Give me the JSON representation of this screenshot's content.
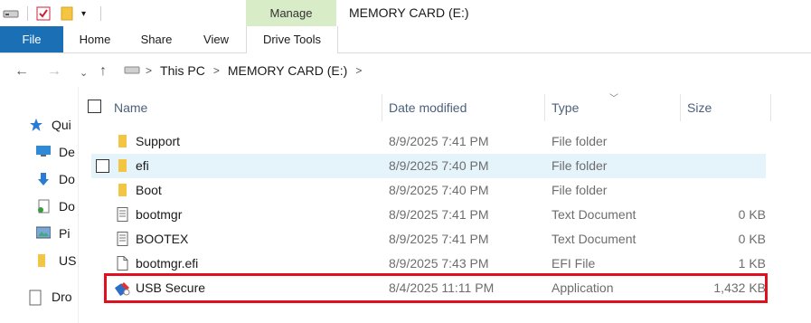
{
  "window": {
    "title": "MEMORY CARD (E:)",
    "context_tab_group": "Manage"
  },
  "ribbon": {
    "tabs": [
      {
        "label": "File"
      },
      {
        "label": "Home"
      },
      {
        "label": "Share"
      },
      {
        "label": "View"
      },
      {
        "label": "Drive Tools"
      }
    ]
  },
  "address": {
    "crumbs": [
      "This PC",
      "MEMORY CARD (E:)"
    ]
  },
  "nav_pane": {
    "items": [
      {
        "label": "Qui",
        "icon": "star-icon"
      },
      {
        "label": "De",
        "icon": "desktop-icon"
      },
      {
        "label": "Do",
        "icon": "download-icon"
      },
      {
        "label": "Do",
        "icon": "documents-icon"
      },
      {
        "label": "Pi",
        "icon": "pictures-icon"
      },
      {
        "label": "US",
        "icon": "folder-icon"
      },
      {
        "label": "Dro",
        "icon": "drive-icon"
      }
    ]
  },
  "columns": {
    "name": "Name",
    "date": "Date modified",
    "type": "Type",
    "size": "Size"
  },
  "files": [
    {
      "name": "Support",
      "date": "8/9/2025 7:41 PM",
      "type": "File folder",
      "size": "",
      "icon": "folder-icon"
    },
    {
      "name": "efi",
      "date": "8/9/2025 7:40 PM",
      "type": "File folder",
      "size": "",
      "icon": "folder-icon"
    },
    {
      "name": "Boot",
      "date": "8/9/2025 7:40 PM",
      "type": "File folder",
      "size": "",
      "icon": "folder-icon"
    },
    {
      "name": "bootmgr",
      "date": "8/9/2025 7:41 PM",
      "type": "Text Document",
      "size": "0 KB",
      "icon": "text-file-icon"
    },
    {
      "name": "BOOTEX",
      "date": "8/9/2025 7:41 PM",
      "type": "Text Document",
      "size": "0 KB",
      "icon": "text-file-icon"
    },
    {
      "name": "bootmgr.efi",
      "date": "8/9/2025 7:43 PM",
      "type": "EFI File",
      "size": "1 KB",
      "icon": "file-icon"
    },
    {
      "name": "USB Secure",
      "date": "8/4/2025 11:11 PM",
      "type": "Application",
      "size": "1,432 KB",
      "icon": "usb-secure-app-icon"
    }
  ],
  "colors": {
    "file_tab": "#1a6fb5",
    "manage_tab": "#d8ecc7",
    "hover_row": "#e5f3fb",
    "highlight": "#e0101e"
  }
}
